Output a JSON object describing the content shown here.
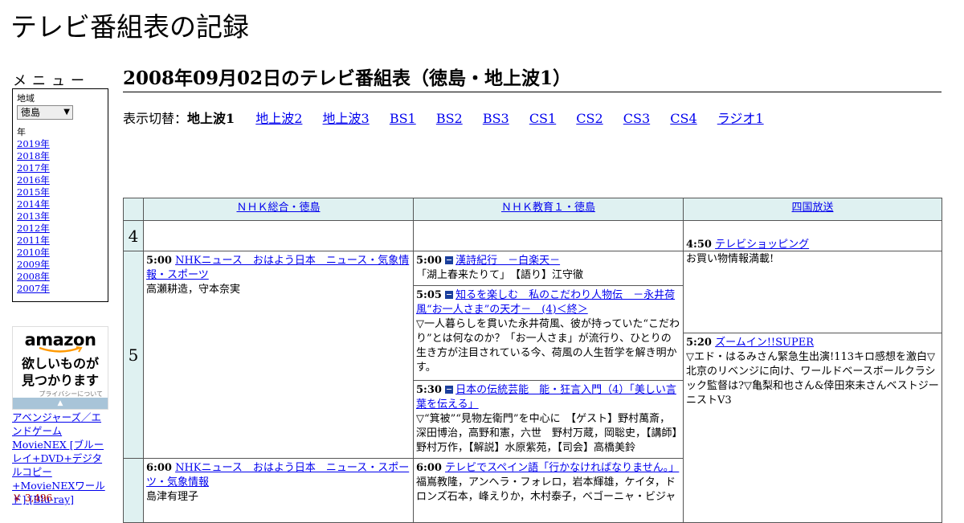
{
  "site_title": "テレビ番組表の記録",
  "sidebar": {
    "menu_heading": "メニュー",
    "region_label": "地域",
    "region_value": "徳島",
    "year_label": "年",
    "years": [
      "2019年",
      "2018年",
      "2017年",
      "2016年",
      "2015年",
      "2014年",
      "2013年",
      "2012年",
      "2011年",
      "2010年",
      "2009年",
      "2008年",
      "2007年"
    ]
  },
  "ad": {
    "logo": "amazon",
    "tagline_1": "欲しいものが",
    "tagline_2": "見つかります",
    "privacy": "プライバシーについて",
    "product": "アベンジャーズ／エンドゲーム MovieNEX [ブルーレイ+DVD+デジタルコピー+MovieNEXワールド] [Blu-ray]",
    "price": "￥ 3,496"
  },
  "page_heading": "2008年09月02日のテレビ番組表（徳島・地上波1）",
  "view_switch": {
    "label": "表示切替：",
    "current": "地上波1",
    "links": [
      "地上波2",
      "地上波3",
      "BS1",
      "BS2",
      "BS3",
      "CS1",
      "CS2",
      "CS3",
      "CS4",
      "ラジオ1"
    ]
  },
  "channels": [
    "ＮＨＫ総合・徳島",
    "ＮＨＫ教育１・徳島",
    "四国放送"
  ],
  "hours": [
    "4",
    "5"
  ],
  "programs": {
    "nhk_sogo": [
      {
        "time": "5:00",
        "title": "NHKニュース　おはよう日本　ニュース・気象情報・スポーツ",
        "desc": "高瀬耕造，守本奈実"
      },
      {
        "time": "6:00",
        "title": "NHKニュース　おはよう日本　ニュース・スポーツ・気象情報",
        "desc": "島津有理子"
      }
    ],
    "nhk_edu": [
      {
        "time": "5:00",
        "title": "漢詩紀行　－白楽天－",
        "desc": "「湖上春来たりて」　【語り】江守徹"
      },
      {
        "time": "5:05",
        "title": "知るを楽しむ　私のこだわり人物伝　－永井荷風“お一人さま”の天才－　(4)＜終＞",
        "desc": "▽一人暮らしを貫いた永井荷風、彼が持っていた“こだわり”とは何なのか？「お一人さま」が流行り、ひとりの生き方が注目されている今、荷風の人生哲学を解き明かす。"
      },
      {
        "time": "5:30",
        "title": "日本の伝統芸能　能・狂言入門（4）「美しい言葉を伝える」",
        "desc": "▽“箕被”“見物左衛門”を中心に　【ゲスト】野村萬斎，深田博治，高野和憲，六世　野村万蔵，岡聡史，【講師】野村万作，【解説】水原紫苑，【司会】高橋美鈴"
      },
      {
        "time": "6:00",
        "title": "テレビでスペイン語「行かなければなりません。」",
        "desc": "福嶌教隆，アンヘラ・フォレロ，岩本輝雄，ケイタ，ドロンズ石本，峰えりか，木村泰子，ベゴーニャ・ビジャ"
      }
    ],
    "shikoku": [
      {
        "time": "4:50",
        "title": "テレビショッピング",
        "desc": "お買い物情報満載!"
      },
      {
        "time": "5:20",
        "title": "ズームイン!!SUPER",
        "desc": "▽エド・はるみさん緊急生出演!113キロ感想を激白▽北京のリベンジに向け、ワールドベースボールクラシック監督は?▽亀梨和也さん&倖田來未さんベストジーニストV3"
      }
    ]
  }
}
